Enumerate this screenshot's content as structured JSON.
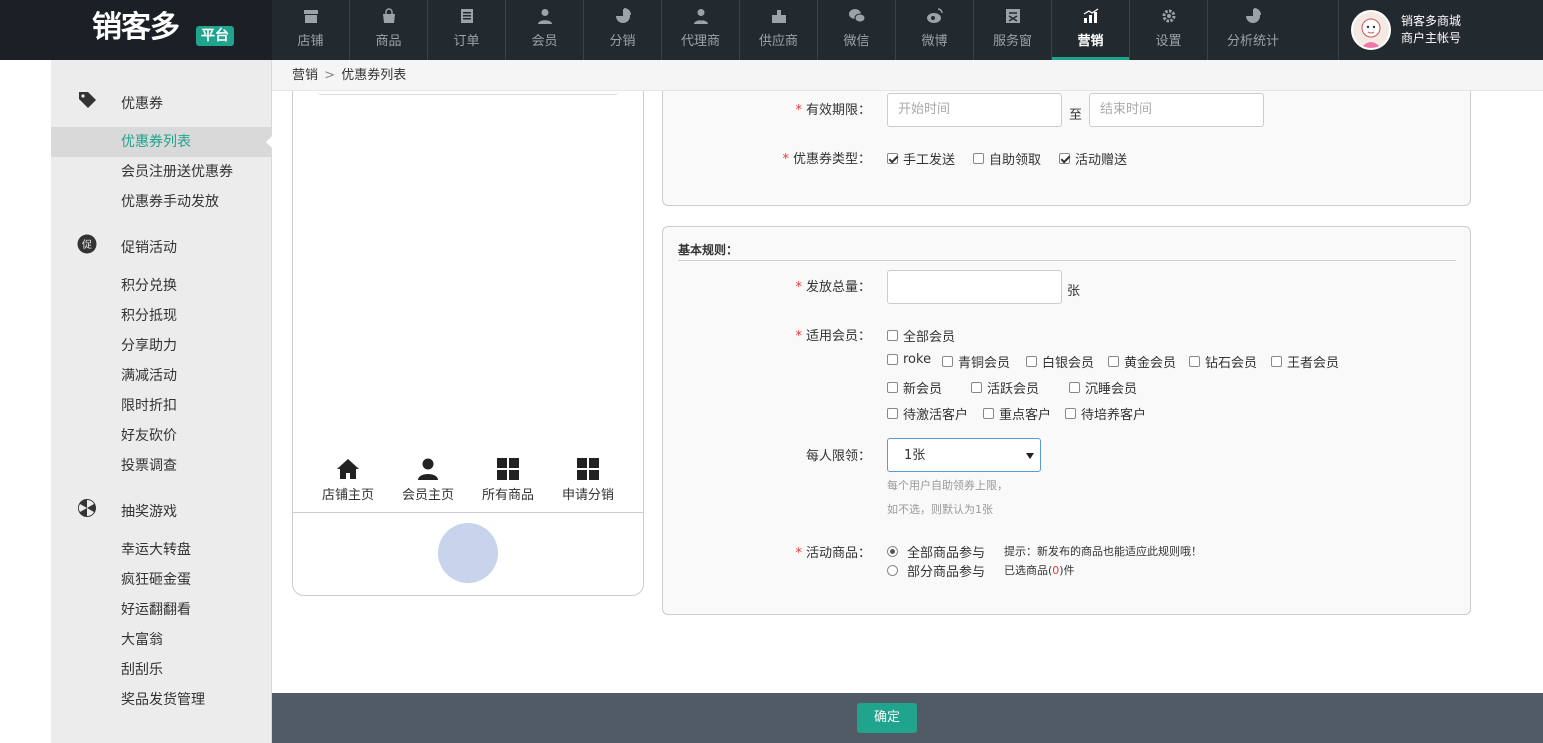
{
  "brand": {
    "name": "销客多",
    "tag": "平台"
  },
  "nav": [
    {
      "label": "店铺",
      "icon": "shop-icon"
    },
    {
      "label": "商品",
      "icon": "bag-icon"
    },
    {
      "label": "订单",
      "icon": "order-icon"
    },
    {
      "label": "会员",
      "icon": "member-icon"
    },
    {
      "label": "分销",
      "icon": "pie-icon"
    },
    {
      "label": "代理商",
      "icon": "agent-icon"
    },
    {
      "label": "供应商",
      "icon": "supplier-icon"
    },
    {
      "label": "微信",
      "icon": "wechat-icon"
    },
    {
      "label": "微博",
      "icon": "weibo-icon"
    },
    {
      "label": "服务窗",
      "icon": "service-icon"
    },
    {
      "label": "营销",
      "icon": "marketing-chart-icon",
      "active": true
    },
    {
      "label": "设置",
      "icon": "gear-icon"
    },
    {
      "label": "分析统计",
      "icon": "analytics-pie-icon"
    }
  ],
  "user": {
    "line1": "销客多商城",
    "line2": "商户主帐号"
  },
  "sidebar": {
    "groups": [
      {
        "label": "优惠券",
        "icon": "coupon-icon",
        "items": [
          "优惠券列表",
          "会员注册送优惠券",
          "优惠券手动发放"
        ]
      },
      {
        "label": "促销活动",
        "icon": "promotion-icon",
        "items": [
          "积分兑换",
          "积分抵现",
          "分享助力",
          "满减活动",
          "限时折扣",
          "好友砍价",
          "投票调查"
        ]
      },
      {
        "label": "抽奖游戏",
        "icon": "lottery-wheel-icon",
        "items": [
          "幸运大转盘",
          "疯狂砸金蛋",
          "好运翻翻看",
          "大富翁",
          "刮刮乐",
          "奖品发货管理"
        ]
      }
    ],
    "active_item": "优惠券列表"
  },
  "breadcrumb": {
    "parent": "营销",
    "separator": ">",
    "current": "优惠券列表"
  },
  "phone": {
    "nav": [
      {
        "label": "店铺主页",
        "icon": "home-icon"
      },
      {
        "label": "会员主页",
        "icon": "user-icon"
      },
      {
        "label": "所有商品",
        "icon": "grid-icon"
      },
      {
        "label": "申请分销",
        "icon": "grid-icon"
      }
    ]
  },
  "form": {
    "validity": {
      "label": "有效期限：",
      "start_placeholder": "开始时间",
      "to": "至",
      "end_placeholder": "结束时间"
    },
    "coupon_type": {
      "label": "优惠券类型：",
      "options": [
        {
          "label": "手工发送",
          "checked": true
        },
        {
          "label": "自助领取",
          "checked": false
        },
        {
          "label": "活动赠送",
          "checked": true
        }
      ]
    },
    "basic_rules_title": "基本规则：",
    "total": {
      "label": "发放总量：",
      "value": "",
      "unit": "张"
    },
    "members": {
      "label": "适用会员：",
      "options": [
        {
          "label": "全部会员",
          "checked": false
        },
        {
          "label": "roke",
          "checked": false
        },
        {
          "label": "青铜会员",
          "checked": false
        },
        {
          "label": "白银会员",
          "checked": false
        },
        {
          "label": "黄金会员",
          "checked": false
        },
        {
          "label": "钻石会员",
          "checked": false
        },
        {
          "label": "王者会员",
          "checked": false
        },
        {
          "label": "新会员",
          "checked": false
        },
        {
          "label": "活跃会员",
          "checked": false
        },
        {
          "label": "沉睡会员",
          "checked": false
        },
        {
          "label": "待激活客户",
          "checked": false
        },
        {
          "label": "重点客户",
          "checked": false
        },
        {
          "label": "待培养客户",
          "checked": false
        }
      ]
    },
    "limit": {
      "label": "每人限领：",
      "selected": "1张",
      "hint1": "每个用户自助领券上限，",
      "hint2": "如不选，则默认为1张"
    },
    "products": {
      "label": "活动商品：",
      "all": {
        "label": "全部商品参与",
        "note": "提示：新发布的商品也能适应此规则哦！",
        "checked": true
      },
      "partial": {
        "label": "部分商品参与",
        "note_prefix": "已选商品(",
        "count": "0",
        "note_suffix": ")件",
        "checked": false
      }
    }
  },
  "footer": {
    "confirm": "确定"
  },
  "colors": {
    "accent": "#20a48d",
    "topbar": "#22292f",
    "required": "#e33333",
    "footer": "#515b66"
  }
}
